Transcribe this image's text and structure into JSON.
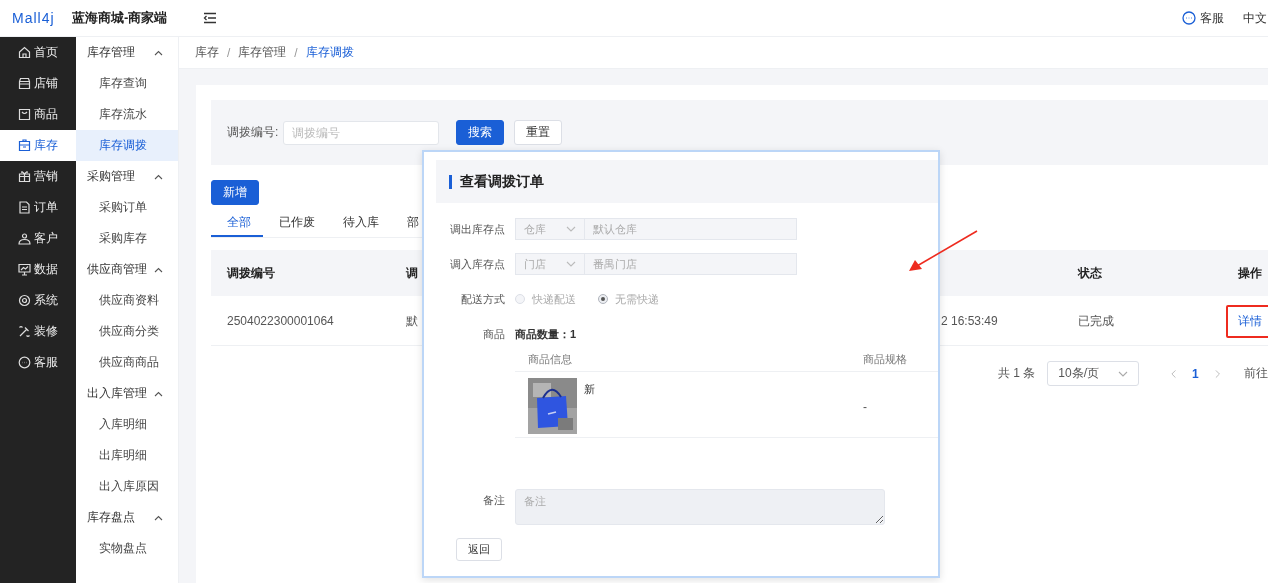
{
  "header": {
    "logo": "Mall4j",
    "title": "蓝海商城-商家端",
    "service": "客服",
    "language": "中文"
  },
  "nav": [
    {
      "label": "首页",
      "selected": false
    },
    {
      "label": "店铺",
      "selected": false
    },
    {
      "label": "商品",
      "selected": false
    },
    {
      "label": "库存",
      "selected": true
    },
    {
      "label": "营销",
      "selected": false
    },
    {
      "label": "订单",
      "selected": false
    },
    {
      "label": "客户",
      "selected": false
    },
    {
      "label": "数据",
      "selected": false
    },
    {
      "label": "系统",
      "selected": false
    },
    {
      "label": "装修",
      "selected": false
    },
    {
      "label": "客服",
      "selected": false
    }
  ],
  "submenu": [
    {
      "label": "库存管理",
      "expanded": true,
      "children": [
        {
          "label": "库存查询",
          "selected": false
        },
        {
          "label": "库存流水",
          "selected": false
        },
        {
          "label": "库存调拨",
          "selected": true
        }
      ]
    },
    {
      "label": "采购管理",
      "expanded": true,
      "children": [
        {
          "label": "采购订单",
          "selected": false
        },
        {
          "label": "采购库存",
          "selected": false
        }
      ]
    },
    {
      "label": "供应商管理",
      "expanded": true,
      "children": [
        {
          "label": "供应商资料",
          "selected": false
        },
        {
          "label": "供应商分类",
          "selected": false
        },
        {
          "label": "供应商商品",
          "selected": false
        }
      ]
    },
    {
      "label": "出入库管理",
      "expanded": true,
      "children": [
        {
          "label": "入库明细",
          "selected": false
        },
        {
          "label": "出库明细",
          "selected": false
        },
        {
          "label": "出入库原因",
          "selected": false
        }
      ]
    },
    {
      "label": "库存盘点",
      "expanded": true,
      "children": [
        {
          "label": "实物盘点",
          "selected": false
        }
      ]
    }
  ],
  "breadcrumb": {
    "separator": "/",
    "items": [
      "库存",
      "库存管理",
      "库存调拨"
    ]
  },
  "search": {
    "label": "调拨编号:",
    "placeholder": "调拨编号",
    "buttons": [
      {
        "label": "搜索",
        "kind": "primary"
      },
      {
        "label": "重置",
        "kind": "default"
      }
    ]
  },
  "add_button": "新增",
  "tabs": [
    {
      "label": "全部",
      "selected": true
    },
    {
      "label": "已作废",
      "selected": false
    },
    {
      "label": "待入库",
      "selected": false
    },
    {
      "label": "部",
      "selected": false
    }
  ],
  "table": {
    "columns": [
      "调拨编号",
      "调",
      "",
      "状态",
      "操作"
    ],
    "rows": [
      {
        "cells": [
          "2504022300001064",
          "默",
          "2 16:53:49",
          "已完成"
        ],
        "action": "详情",
        "action_highlighted": true
      }
    ]
  },
  "pagination": {
    "total": "共 1 条",
    "page_size": "10条/页",
    "pages": [
      {
        "label": "1",
        "selected": true
      }
    ],
    "jump": "前往"
  },
  "dialog": {
    "title": "查看调拨订单",
    "points": [
      {
        "label": "调出库存点",
        "type": "仓库",
        "value": "默认仓库",
        "disabled": true
      },
      {
        "label": "调入库存点",
        "type": "门店",
        "value": "番禺门店",
        "disabled": true
      }
    ],
    "delivery": {
      "label": "配送方式",
      "disabled": true,
      "options": [
        {
          "label": "快递配送",
          "selected": false
        },
        {
          "label": "无需快递",
          "selected": true
        }
      ]
    },
    "goods": {
      "label": "商品",
      "count": "商品数量：1",
      "columns": [
        "商品信息",
        "商品规格"
      ],
      "rows": [
        {
          "kind": "picture",
          "name": "新",
          "spec": "-"
        }
      ]
    },
    "remark": {
      "label": "备注",
      "placeholder": "备注",
      "disabled": true
    },
    "back_button": "返回"
  },
  "annotations": [
    {
      "kind": "arrow"
    }
  ]
}
